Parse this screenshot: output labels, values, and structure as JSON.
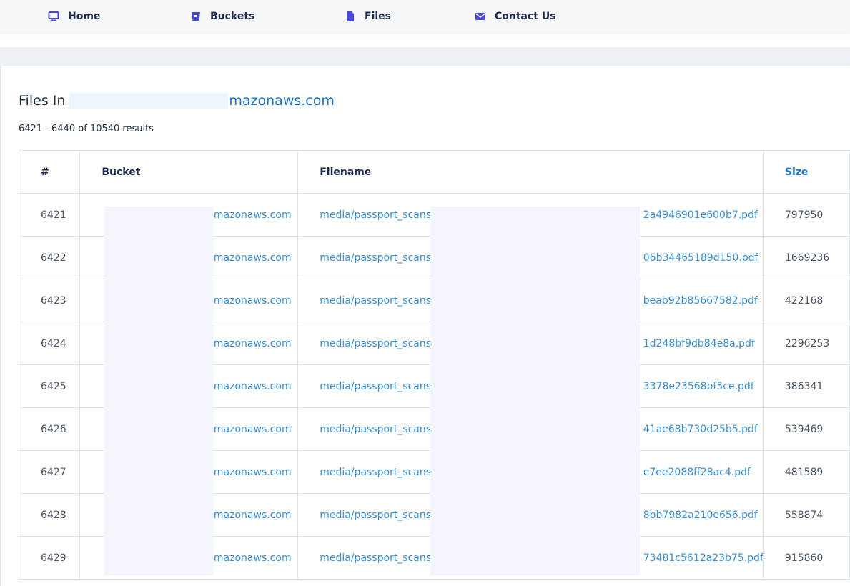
{
  "nav": {
    "items": [
      {
        "label": "Home",
        "icon": "monitor-icon"
      },
      {
        "label": "Buckets",
        "icon": "bucket-icon"
      },
      {
        "label": "Files",
        "icon": "file-icon"
      },
      {
        "label": "Contact Us",
        "icon": "envelope-icon"
      }
    ]
  },
  "page": {
    "title_prefix": "Files In",
    "title_host": "mazonaws.com",
    "results_text": "6421 - 6440 of 10540 results"
  },
  "table": {
    "headers": [
      "#",
      "Bucket",
      "Filename",
      "Size"
    ],
    "rows": [
      {
        "num": "6421",
        "bucket": "amazonaws.com",
        "filename": "media/passport_scans/",
        "suffix": "2a4946901e600b7.pdf",
        "size": "797950"
      },
      {
        "num": "6422",
        "bucket": "amazonaws.com",
        "filename": "media/passport_scans/",
        "suffix": "06b34465189d150.pdf",
        "size": "1669236"
      },
      {
        "num": "6423",
        "bucket": "amazonaws.com",
        "filename": "media/passport_scans/",
        "suffix": "beab92b85667582.pdf",
        "size": "422168"
      },
      {
        "num": "6424",
        "bucket": "amazonaws.com",
        "filename": "media/passport_scans/",
        "suffix": "1d248bf9db84e8a.pdf",
        "size": "2296253"
      },
      {
        "num": "6425",
        "bucket": "amazonaws.com",
        "filename": "media/passport_scans/",
        "suffix": "3378e23568bf5ce.pdf",
        "size": "386341"
      },
      {
        "num": "6426",
        "bucket": "amazonaws.com",
        "filename": "media/passport_scans/",
        "suffix": "41ae68b730d25b5.pdf",
        "size": "539469"
      },
      {
        "num": "6427",
        "bucket": "amazonaws.com",
        "filename": "media/passport_scans/",
        "suffix": "e7ee2088ff28ac4.pdf",
        "size": "481589"
      },
      {
        "num": "6428",
        "bucket": "amazonaws.com",
        "filename": "media/passport_scans/",
        "suffix": "8bb7982a210e656.pdf",
        "size": "558874"
      },
      {
        "num": "6429",
        "bucket": "amazonaws.com",
        "filename": "media/passport_scans/",
        "suffix": "73481c5612a23b75.pdf",
        "size": "915860"
      }
    ]
  },
  "colors": {
    "accent": "#1a73c9",
    "link": "#3a8fd4",
    "nav_icon": "#4a47d6"
  }
}
